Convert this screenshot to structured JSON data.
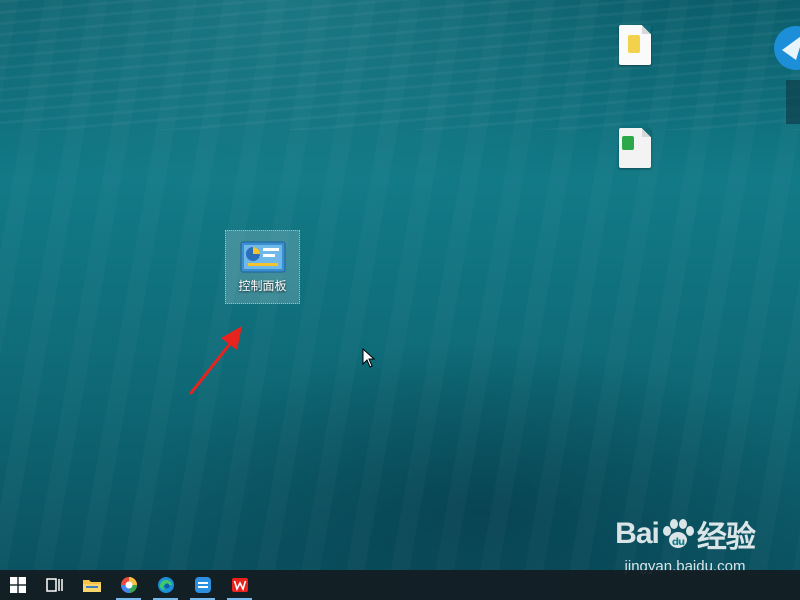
{
  "desktop": {
    "control_panel_label": "控制面板",
    "blurred_label_1": "",
    "blurred_label_2": ""
  },
  "watermark": {
    "brand": "Bai",
    "brand_suffix": "经验",
    "url": "jingyan.baidu.com"
  },
  "taskbar": {
    "items": [
      {
        "name": "start",
        "icon": "windows-logo-icon"
      },
      {
        "name": "task-view",
        "icon": "task-view-icon"
      },
      {
        "name": "file-explorer",
        "icon": "folder-icon"
      },
      {
        "name": "browser",
        "icon": "colorful-browser-icon"
      },
      {
        "name": "edge",
        "icon": "edge-icon"
      },
      {
        "name": "app",
        "icon": "blue-app-icon"
      },
      {
        "name": "wps",
        "icon": "wps-icon"
      }
    ]
  },
  "colors": {
    "arrow": "#e8231e",
    "taskbar_accent": "#76b9ed"
  }
}
